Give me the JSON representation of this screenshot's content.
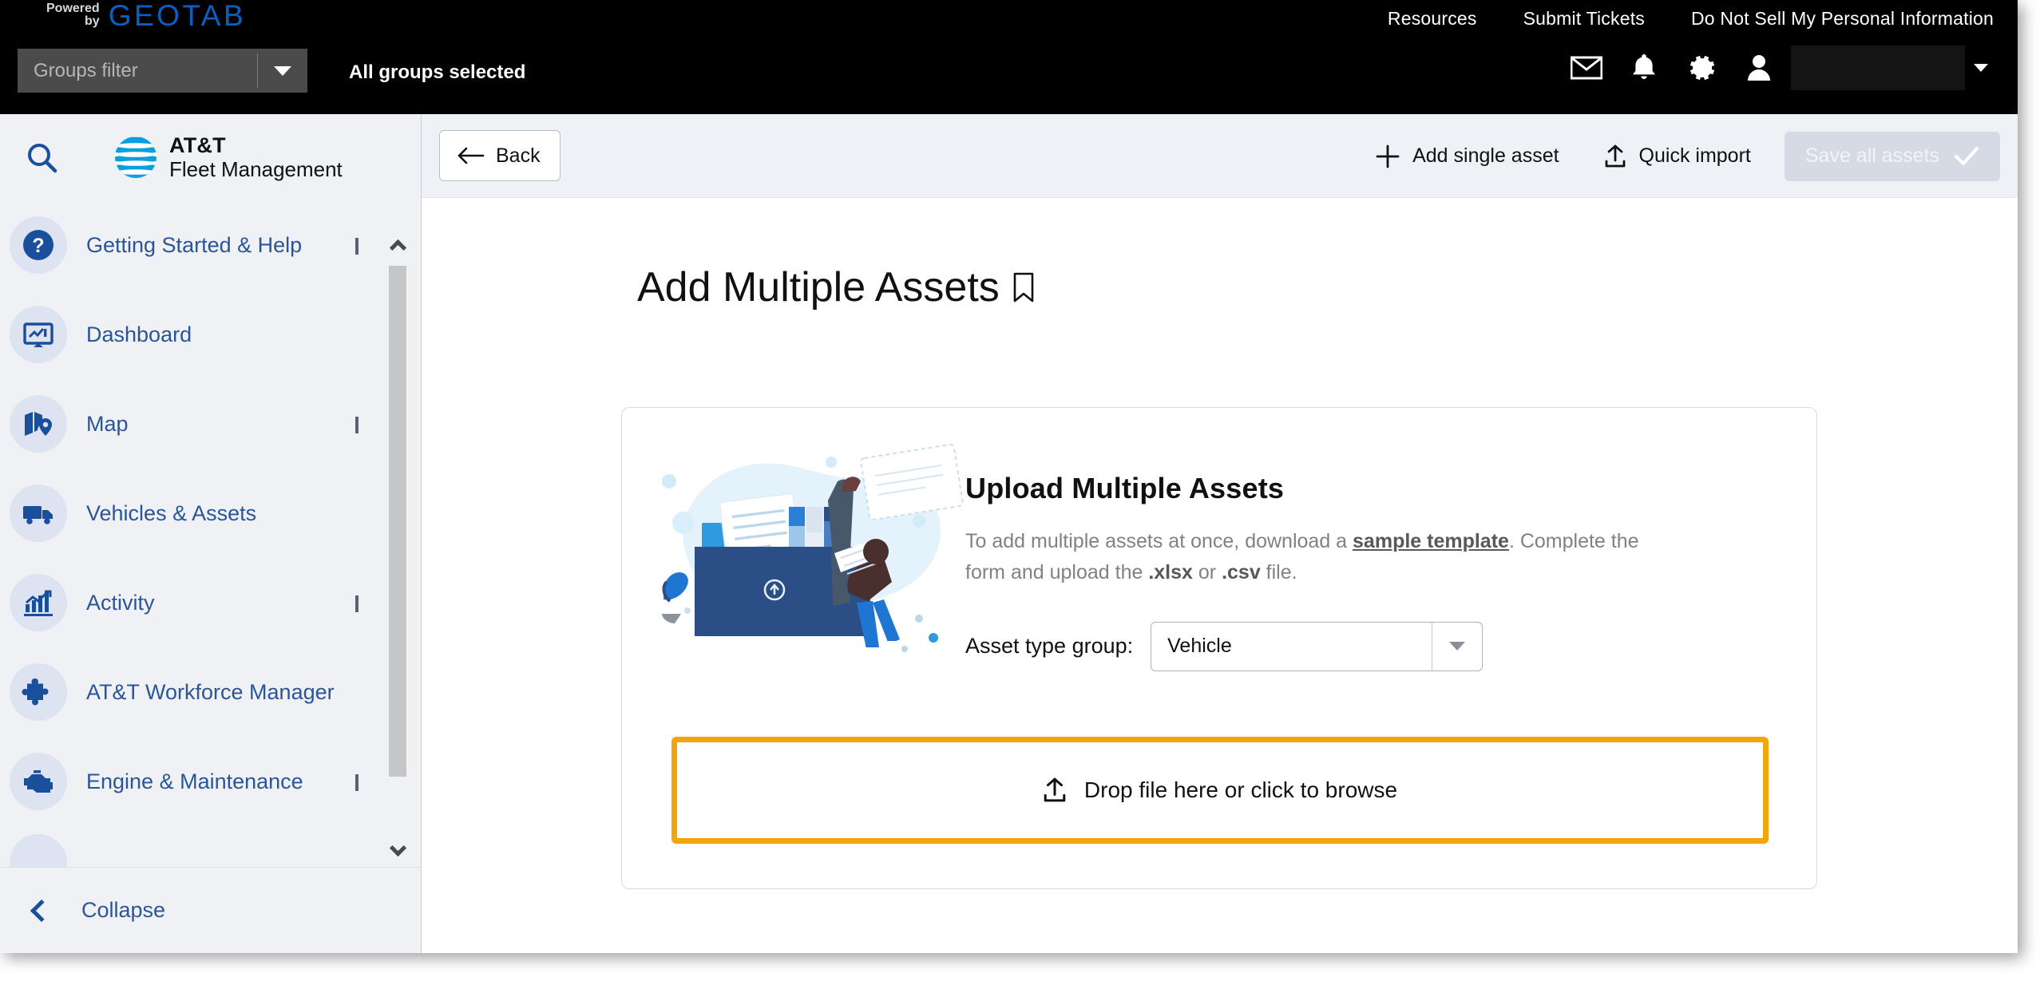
{
  "topbar": {
    "powered_line1": "Powered",
    "powered_line2": "by",
    "brand": "GEOTAB",
    "util_links": [
      {
        "label": "Resources",
        "name": "resources-link"
      },
      {
        "label": "Submit Tickets",
        "name": "submit-tickets-link"
      },
      {
        "label": "Do Not Sell My Personal Information",
        "name": "do-not-sell-link"
      }
    ],
    "groups_filter_placeholder": "Groups filter",
    "groups_filter_value": "",
    "groups_selected_text": "All groups selected",
    "icons": [
      {
        "name": "mail-icon",
        "label": "Messages"
      },
      {
        "name": "bell-icon",
        "label": "Notifications"
      },
      {
        "name": "gear-icon",
        "label": "Settings"
      },
      {
        "name": "user-icon",
        "label": "Account"
      }
    ],
    "user_name": ""
  },
  "sidebar": {
    "search_placeholder": "Search",
    "logo_line1": "AT&T",
    "logo_line2": "Fleet Management",
    "items": [
      {
        "label": "Getting Started & Help",
        "icon": "question-circle-icon",
        "expandable": true
      },
      {
        "label": "Dashboard",
        "icon": "dashboard-monitor-icon",
        "expandable": false
      },
      {
        "label": "Map",
        "icon": "map-pin-icon",
        "expandable": true
      },
      {
        "label": "Vehicles & Assets",
        "icon": "truck-icon",
        "expandable": false
      },
      {
        "label": "Activity",
        "icon": "chart-bars-icon",
        "expandable": true
      },
      {
        "label": "AT&T Workforce Manager",
        "icon": "puzzle-piece-icon",
        "expandable": false
      },
      {
        "label": "Engine & Maintenance",
        "icon": "engine-icon",
        "expandable": true
      }
    ],
    "collapse_label": "Collapse"
  },
  "toolbar": {
    "back_label": "Back",
    "add_single_asset_label": "Add single asset",
    "quick_import_label": "Quick import",
    "save_all_assets_label": "Save all assets",
    "save_all_assets_disabled": true
  },
  "page": {
    "title": "Add Multiple Assets",
    "bookmark_icon": "bookmark-icon"
  },
  "card": {
    "heading": "Upload Multiple Assets",
    "desc_part1": "To add multiple assets at once, download a ",
    "desc_link": "sample template",
    "desc_part2": ". Complete the form and upload the ",
    "desc_ext1": ".xlsx",
    "desc_mid": " or ",
    "desc_ext2": ".csv",
    "desc_part3": " file.",
    "asset_type_label": "Asset type group:",
    "asset_type_value": "Vehicle",
    "dropzone_label": "Drop file here or click to browse",
    "dropzone_highlight_color": "#f2a50c"
  },
  "colors": {
    "topbar_bg": "#000000",
    "sidebar_bg": "#eff1f4",
    "link_blue": "#2a5699",
    "geotab_blue": "#0b5fc1",
    "accent_orange": "#f2a50c",
    "toolbar_bg": "#eef1f6"
  }
}
